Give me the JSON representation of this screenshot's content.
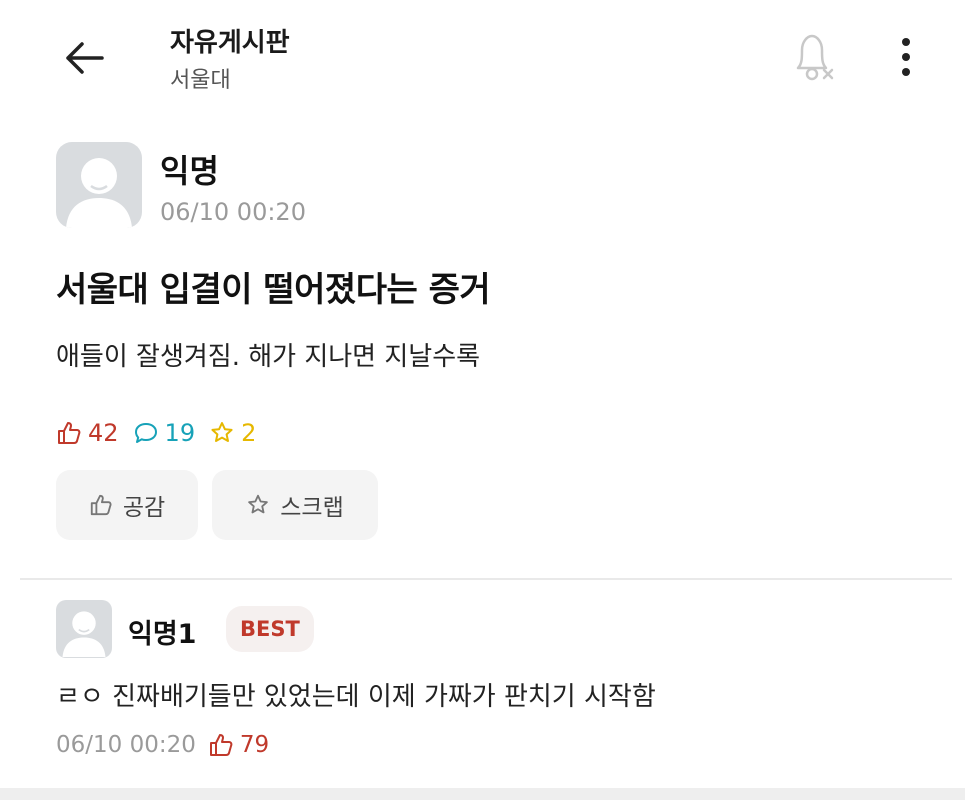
{
  "header": {
    "board_title": "자유게시판",
    "board_subtitle": "서울대"
  },
  "post": {
    "author": "익명",
    "time": "06/10 00:20",
    "title": "서울대 입결이 떨어졌다는 증거",
    "body": "애들이 잘생겨짐. 해가 지나면 지날수록",
    "stats": {
      "likes": "42",
      "comments": "19",
      "scraps": "2"
    },
    "buttons": {
      "like_label": "공감",
      "scrap_label": "스크랩"
    }
  },
  "comment": {
    "author": "익명1",
    "badge": "BEST",
    "body": "ㄹㅇ 진짜배기들만 있었는데 이제 가짜가 판치기 시작함",
    "time": "06/10 00:20",
    "likes": "79"
  },
  "colors": {
    "like": "#c0392b",
    "comment": "#17a2b8",
    "scrap": "#e6b800",
    "avatar": "#d9dcdf"
  },
  "icons": [
    "back-arrow-icon",
    "bell-off-icon",
    "more-vertical-icon",
    "thumbs-up-icon",
    "comment-icon",
    "star-icon",
    "avatar-icon"
  ]
}
